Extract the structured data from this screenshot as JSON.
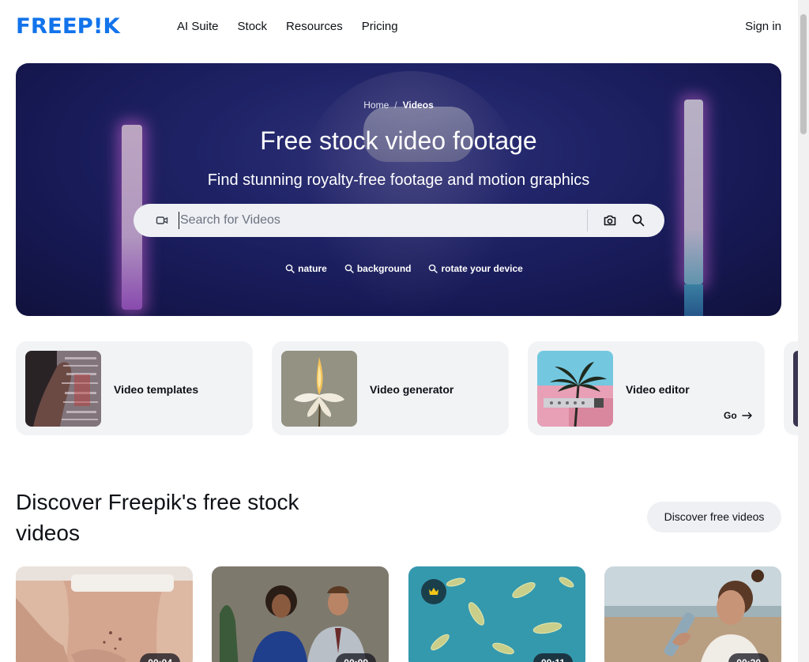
{
  "brand": {
    "logo_text": "FREEP!K",
    "color": "#1273eb"
  },
  "nav": {
    "items": [
      "AI Suite",
      "Stock",
      "Resources",
      "Pricing"
    ],
    "signin": "Sign in"
  },
  "hero": {
    "breadcrumb": {
      "home": "Home",
      "separator": "/",
      "current": "Videos"
    },
    "title": "Free stock video footage",
    "subtitle": "Find stunning royalty-free footage and motion graphics",
    "search": {
      "placeholder": "Search for Videos",
      "value": ""
    },
    "tags": [
      "nature",
      "background",
      "rotate your device"
    ]
  },
  "tools": [
    {
      "label": "Video templates"
    },
    {
      "label": "Video generator"
    },
    {
      "label": "Video editor",
      "go": "Go"
    }
  ],
  "section": {
    "title": "Discover Freepik's free stock videos",
    "button": "Discover free videos"
  },
  "videos": [
    {
      "duration": "00:04",
      "premium": false
    },
    {
      "duration": "00:09",
      "premium": false
    },
    {
      "duration": "00:11",
      "premium": true
    },
    {
      "duration": "00:20",
      "premium": false
    }
  ],
  "icons": {
    "video": "video-camera-icon",
    "camera": "camera-icon",
    "search": "search-icon",
    "tag": "search-icon",
    "arrow": "arrow-right-icon",
    "crown": "crown-icon"
  }
}
